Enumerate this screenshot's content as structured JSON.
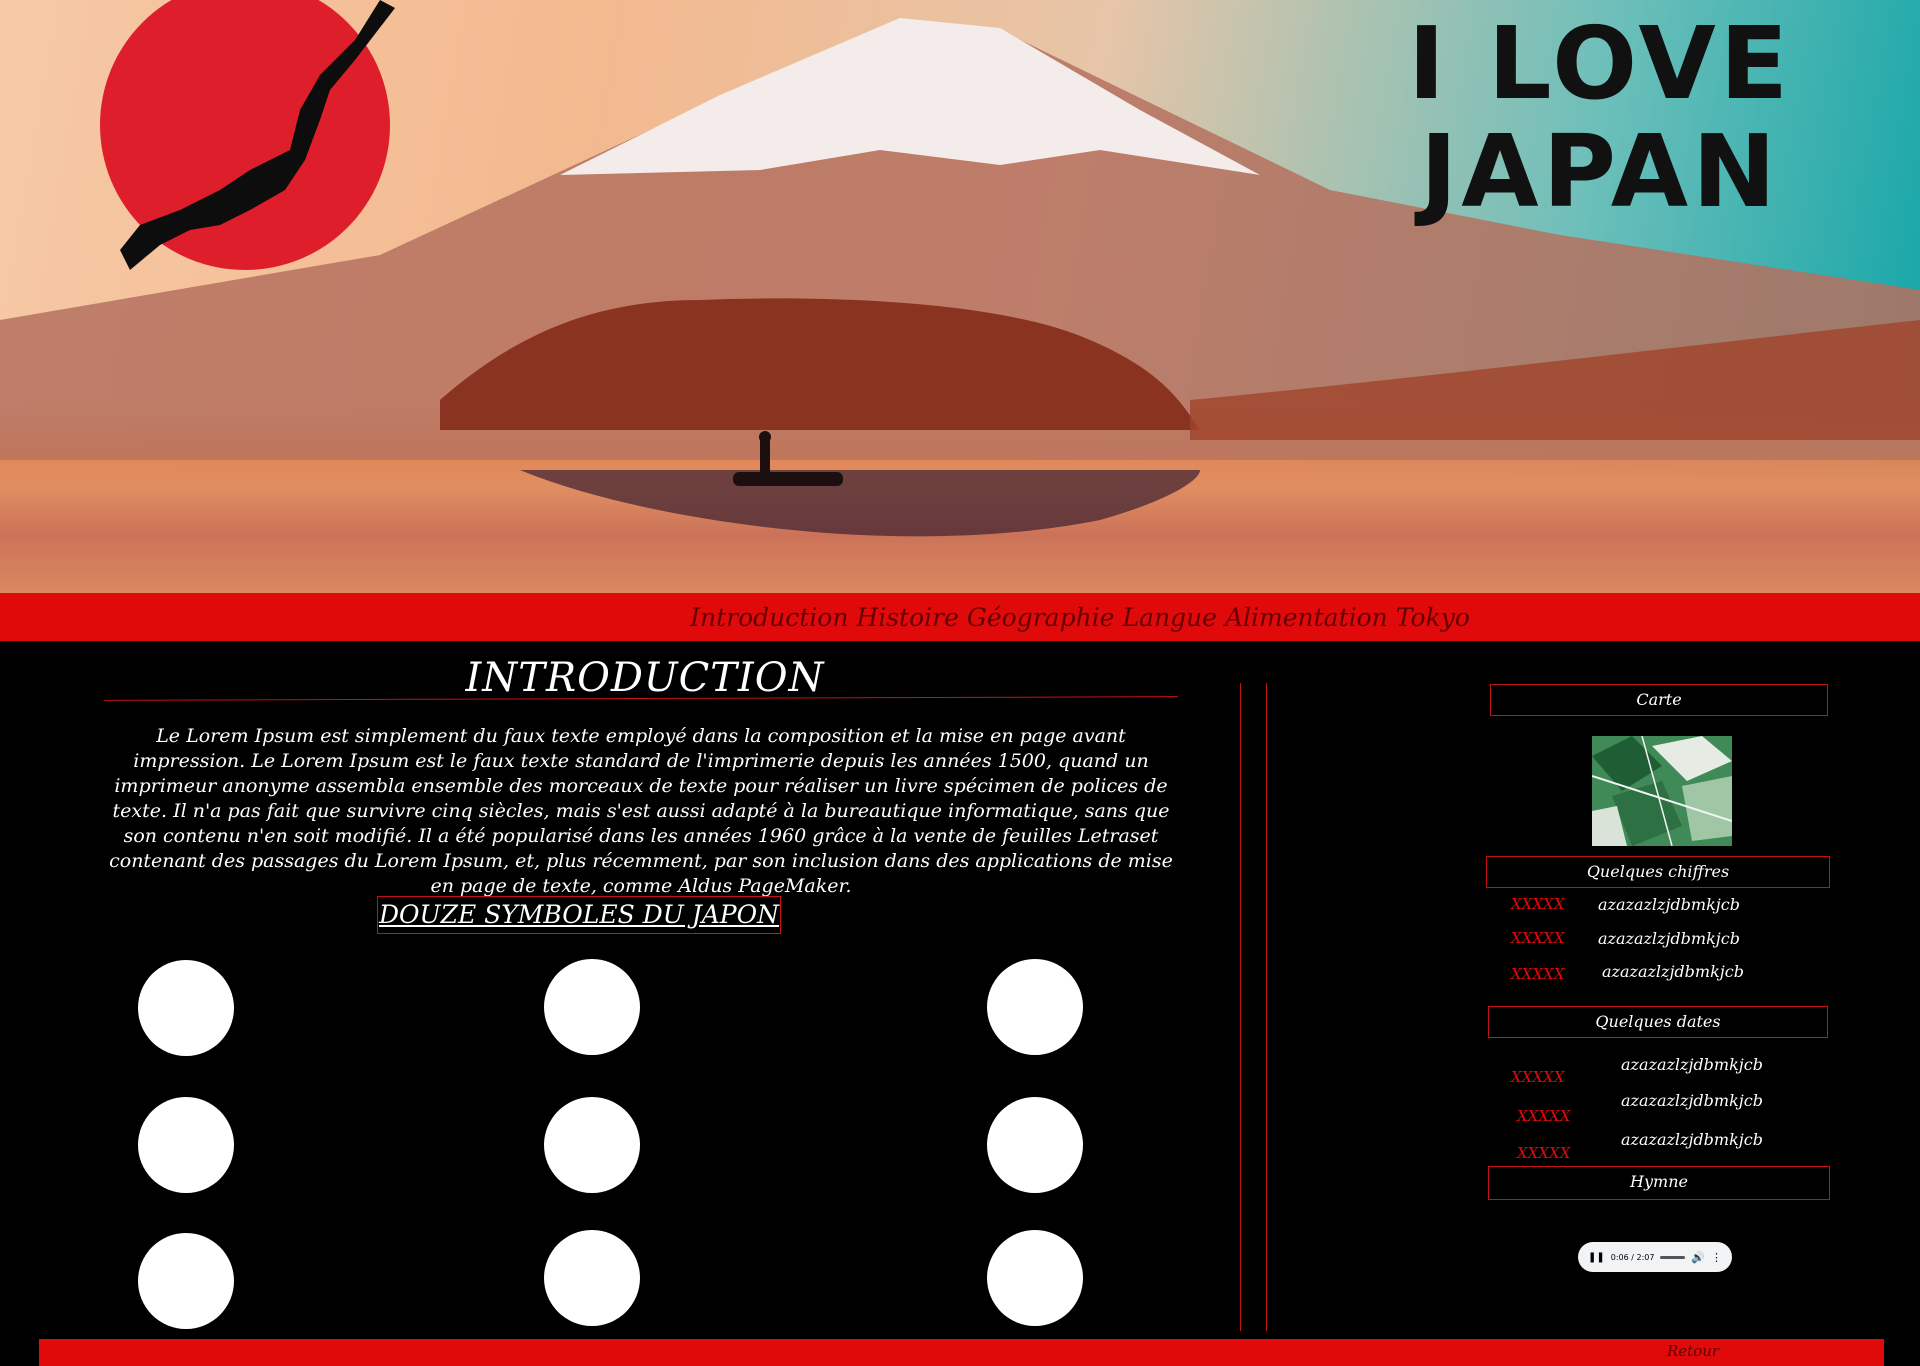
{
  "hero": {
    "title_line1": "I LOVE",
    "title_line2": "JAPAN"
  },
  "nav": {
    "items": [
      {
        "label": "Introduction"
      },
      {
        "label": "Histoire"
      },
      {
        "label": "Géographie"
      },
      {
        "label": "Langue"
      },
      {
        "label": "Alimentation"
      },
      {
        "label": "Tokyo"
      }
    ]
  },
  "main": {
    "intro_title": "INTRODUCTION",
    "intro_text": "Le Lorem Ipsum est simplement du faux texte employé dans la composition et la mise en page avant impression. Le Lorem Ipsum est le faux texte standard de l'imprimerie depuis les années 1500, quand un imprimeur anonyme assembla ensemble des morceaux de texte pour réaliser un livre spécimen de polices de texte. Il n'a pas fait que survivre cinq siècles, mais s'est aussi adapté à la bureautique informatique, sans que son contenu n'en soit modifié. Il a été popularisé dans les années 1960 grâce à la vente de feuilles Letraset contenant des passages du Lorem Ipsum, et, plus récemment, par son inclusion dans des applications de mise en page de texte, comme Aldus PageMaker.",
    "symbols_title": "DOUZE SYMBOLES DU JAPON"
  },
  "sidebar": {
    "map_title": "Carte",
    "figures_title": "Quelques chiffres",
    "figures": [
      {
        "label": "XXXXX",
        "value": "azazazlzjdbmkjcb"
      },
      {
        "label": "XXXXX",
        "value": "azazazlzjdbmkjcb"
      },
      {
        "label": "XXXXX",
        "value": "azazazlzjdbmkjcb"
      }
    ],
    "dates_title": "Quelques dates",
    "dates": [
      {
        "label": "XXXXX",
        "value": "azazazlzjdbmkjcb"
      },
      {
        "label": "XXXXX",
        "value": "azazazlzjdbmkjcb"
      },
      {
        "label": "XXXXX",
        "value": "azazazlzjdbmkjcb"
      }
    ],
    "anthem_title": "Hymne",
    "audio_time": "0:06 / 2:07"
  },
  "footer": {
    "back_label": "Retour"
  },
  "colors": {
    "accent_red": "#e10a0a",
    "dark_red_text": "#650000",
    "background": "#000000"
  }
}
